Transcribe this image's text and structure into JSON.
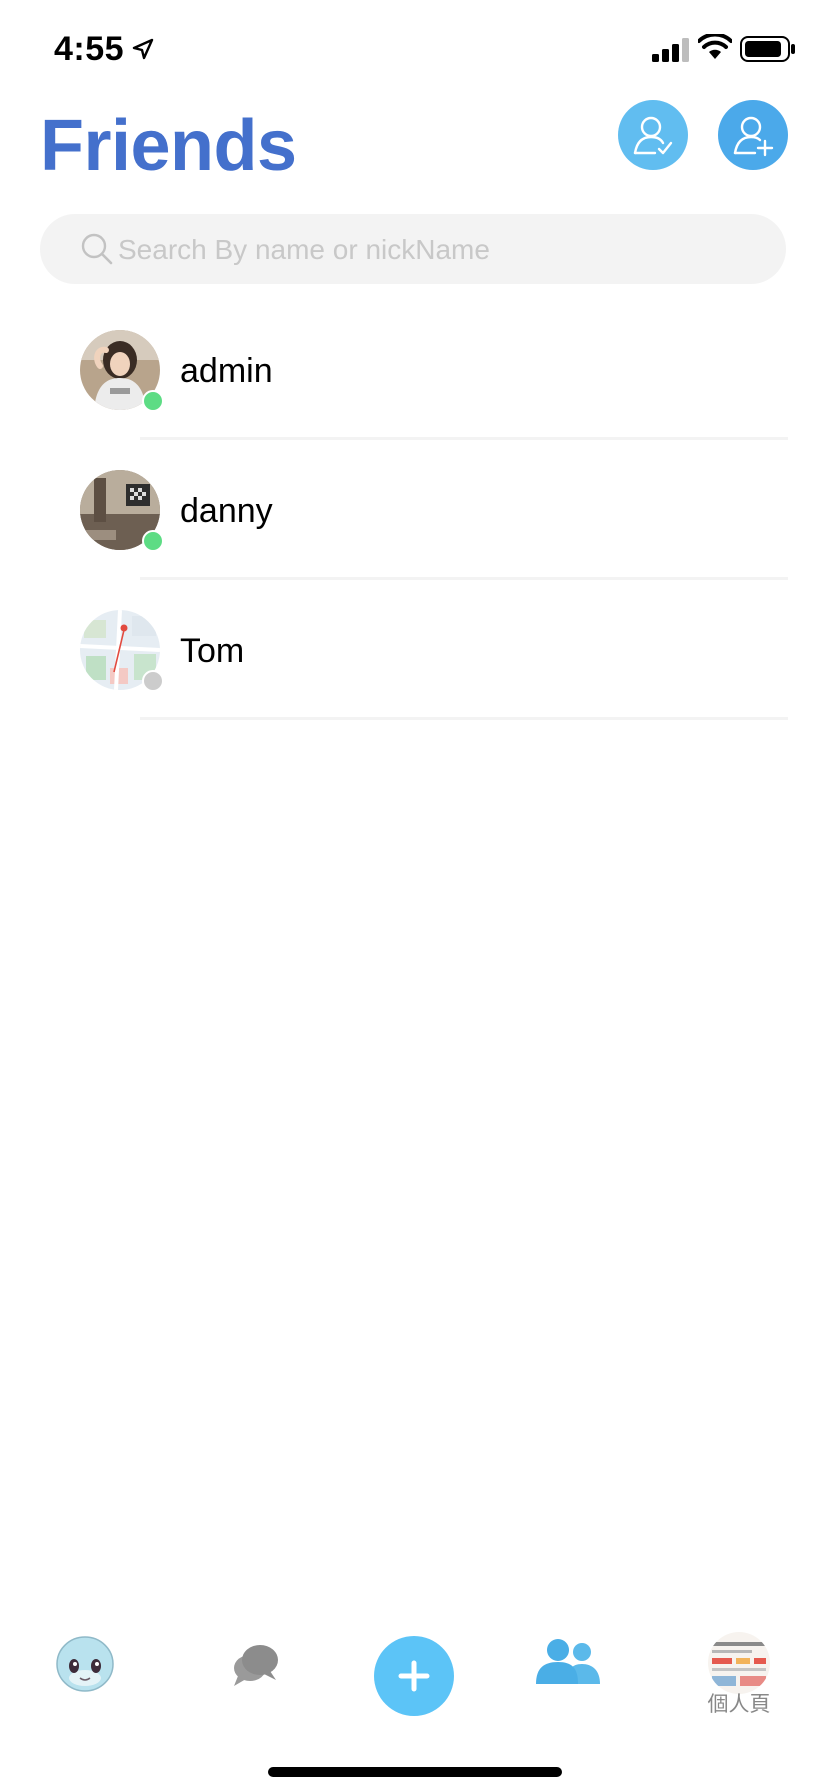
{
  "status_bar": {
    "time": "4:55",
    "icons": [
      "location-arrow-icon",
      "cellular-signal-icon",
      "wifi-icon",
      "battery-icon"
    ]
  },
  "header": {
    "title": "Friends",
    "title_color": "#4470cc",
    "buttons": [
      {
        "icon": "friend-requests-icon",
        "color": "#61bdf0"
      },
      {
        "icon": "add-friend-icon",
        "color": "#4ba9ea"
      }
    ]
  },
  "search": {
    "placeholder": "Search By name or nickName",
    "value": ""
  },
  "friends": [
    {
      "name": "admin",
      "status": "online"
    },
    {
      "name": "danny",
      "status": "online"
    },
    {
      "name": "Tom",
      "status": "offline"
    }
  ],
  "tab_bar": {
    "tabs": [
      {
        "icon": "squirtle-home-icon",
        "label": ""
      },
      {
        "icon": "chat-bubbles-icon",
        "label": ""
      },
      {
        "icon": "plus-icon",
        "label": ""
      },
      {
        "icon": "friends-icon",
        "label": "",
        "active": true
      },
      {
        "icon": "profile-avatar",
        "label": "個人頁"
      }
    ]
  },
  "colors": {
    "accent": "#4470cc",
    "online": "#5ddc84",
    "offline": "#cccccc",
    "create_button": "#5cc4f7"
  }
}
